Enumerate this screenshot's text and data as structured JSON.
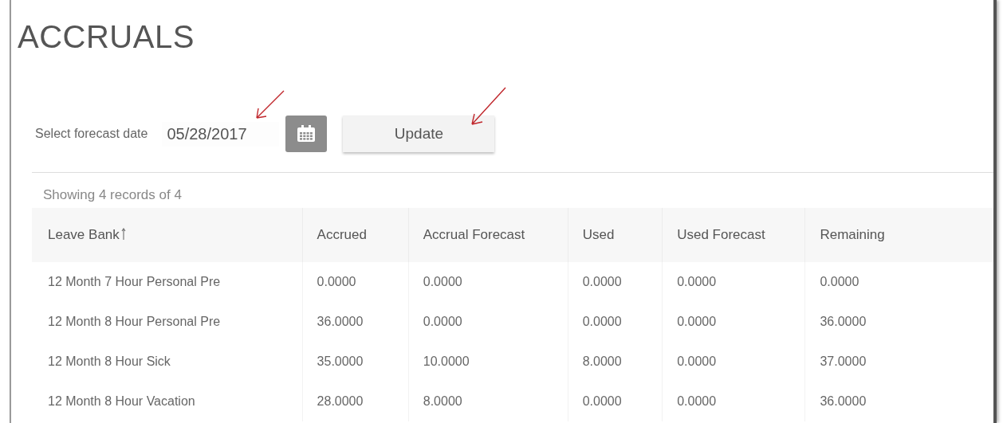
{
  "title": "ACCRUALS",
  "forecast": {
    "label": "Select forecast date",
    "value": "05/28/2017",
    "button": "Update"
  },
  "record_count": "Showing 4 records of 4",
  "table": {
    "columns": [
      {
        "label": "Leave Bank",
        "sorted": true
      },
      {
        "label": "Accrued",
        "sorted": false
      },
      {
        "label": "Accrual Forecast",
        "sorted": false
      },
      {
        "label": "Used",
        "sorted": false
      },
      {
        "label": "Used Forecast",
        "sorted": false
      },
      {
        "label": "Remaining",
        "sorted": false
      }
    ],
    "rows": [
      [
        "12 Month 7 Hour Personal Pre",
        "0.0000",
        "0.0000",
        "0.0000",
        "0.0000",
        "0.0000"
      ],
      [
        "12 Month 8 Hour Personal Pre",
        "36.0000",
        "0.0000",
        "0.0000",
        "0.0000",
        "36.0000"
      ],
      [
        "12 Month 8 Hour Sick",
        "35.0000",
        "10.0000",
        "8.0000",
        "0.0000",
        "37.0000"
      ],
      [
        "12 Month 8 Hour Vacation",
        "28.0000",
        "8.0000",
        "0.0000",
        "0.0000",
        "36.0000"
      ]
    ]
  }
}
